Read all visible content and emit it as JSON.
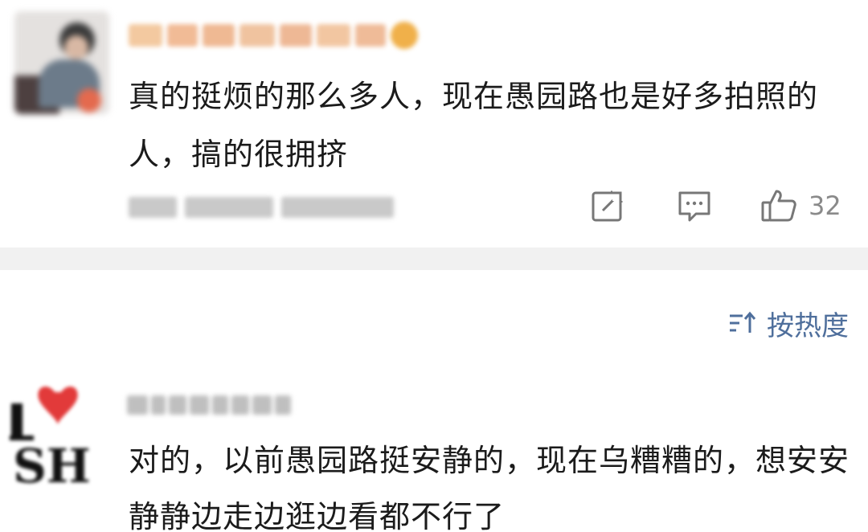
{
  "comments": [
    {
      "text": "真的挺烦的那么多人，现在愚园路也是好多拍照的人，搞的很拥挤",
      "likes": "32"
    },
    {
      "text": "对的，以前愚园路挺安静的，现在乌糟糟的，想安安静静边走边逛边看都不行了"
    }
  ],
  "sort": {
    "label": "按热度",
    "icon": "sort-icon"
  },
  "icons": {
    "share": "share-icon",
    "comment": "comment-icon",
    "like": "thumbs-up-icon"
  },
  "colors": {
    "text": "#1b1b1b",
    "meta": "#8a8a8a",
    "accent": "#4f6f9c",
    "divider": "#f1f1f1"
  }
}
